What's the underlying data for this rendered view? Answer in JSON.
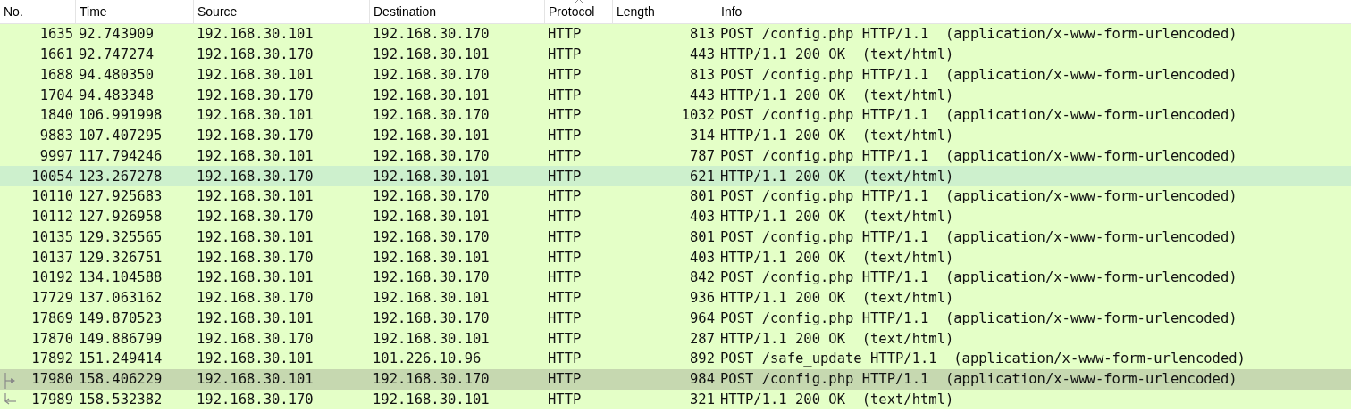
{
  "columns": [
    {
      "label": "No.",
      "kind": "number",
      "sorted": false
    },
    {
      "label": "Time",
      "kind": "text",
      "sorted": false
    },
    {
      "label": "Source",
      "kind": "text",
      "sorted": false
    },
    {
      "label": "Destination",
      "kind": "text",
      "sorted": false
    },
    {
      "label": "Protocol",
      "kind": "text",
      "sorted": true
    },
    {
      "label": "Length",
      "kind": "number",
      "sorted": false
    },
    {
      "label": "Info",
      "kind": "text",
      "sorted": false
    }
  ],
  "rows": [
    {
      "cells": [
        "1635",
        "92.743909",
        "192.168.30.101",
        "192.168.30.170",
        "HTTP",
        "813",
        "POST /config.php HTTP/1.1  (application/x-www-form-urlencoded)"
      ],
      "selected": false,
      "hovered": false
    },
    {
      "cells": [
        "1661",
        "92.747274",
        "192.168.30.170",
        "192.168.30.101",
        "HTTP",
        "443",
        "HTTP/1.1 200 OK  (text/html)"
      ],
      "selected": false,
      "hovered": false
    },
    {
      "cells": [
        "1688",
        "94.480350",
        "192.168.30.101",
        "192.168.30.170",
        "HTTP",
        "813",
        "POST /config.php HTTP/1.1  (application/x-www-form-urlencoded)"
      ],
      "selected": false,
      "hovered": false
    },
    {
      "cells": [
        "1704",
        "94.483348",
        "192.168.30.170",
        "192.168.30.101",
        "HTTP",
        "443",
        "HTTP/1.1 200 OK  (text/html)"
      ],
      "selected": false,
      "hovered": false
    },
    {
      "cells": [
        "1840",
        "106.991998",
        "192.168.30.101",
        "192.168.30.170",
        "HTTP",
        "1032",
        "POST /config.php HTTP/1.1  (application/x-www-form-urlencoded)"
      ],
      "selected": false,
      "hovered": false
    },
    {
      "cells": [
        "9883",
        "107.407295",
        "192.168.30.170",
        "192.168.30.101",
        "HTTP",
        "314",
        "HTTP/1.1 200 OK  (text/html)"
      ],
      "selected": false,
      "hovered": false
    },
    {
      "cells": [
        "9997",
        "117.794246",
        "192.168.30.101",
        "192.168.30.170",
        "HTTP",
        "787",
        "POST /config.php HTTP/1.1  (application/x-www-form-urlencoded)"
      ],
      "selected": false,
      "hovered": false
    },
    {
      "cells": [
        "10054",
        "123.267278",
        "192.168.30.170",
        "192.168.30.101",
        "HTTP",
        "621",
        "HTTP/1.1 200 OK  (text/html)"
      ],
      "selected": false,
      "hovered": true
    },
    {
      "cells": [
        "10110",
        "127.925683",
        "192.168.30.101",
        "192.168.30.170",
        "HTTP",
        "801",
        "POST /config.php HTTP/1.1  (application/x-www-form-urlencoded)"
      ],
      "selected": false,
      "hovered": false
    },
    {
      "cells": [
        "10112",
        "127.926958",
        "192.168.30.170",
        "192.168.30.101",
        "HTTP",
        "403",
        "HTTP/1.1 200 OK  (text/html)"
      ],
      "selected": false,
      "hovered": false
    },
    {
      "cells": [
        "10135",
        "129.325565",
        "192.168.30.101",
        "192.168.30.170",
        "HTTP",
        "801",
        "POST /config.php HTTP/1.1  (application/x-www-form-urlencoded)"
      ],
      "selected": false,
      "hovered": false
    },
    {
      "cells": [
        "10137",
        "129.326751",
        "192.168.30.170",
        "192.168.30.101",
        "HTTP",
        "403",
        "HTTP/1.1 200 OK  (text/html)"
      ],
      "selected": false,
      "hovered": false
    },
    {
      "cells": [
        "10192",
        "134.104588",
        "192.168.30.101",
        "192.168.30.170",
        "HTTP",
        "842",
        "POST /config.php HTTP/1.1  (application/x-www-form-urlencoded)"
      ],
      "selected": false,
      "hovered": false
    },
    {
      "cells": [
        "17729",
        "137.063162",
        "192.168.30.170",
        "192.168.30.101",
        "HTTP",
        "936",
        "HTTP/1.1 200 OK  (text/html)"
      ],
      "selected": false,
      "hovered": false
    },
    {
      "cells": [
        "17869",
        "149.870523",
        "192.168.30.101",
        "192.168.30.170",
        "HTTP",
        "964",
        "POST /config.php HTTP/1.1  (application/x-www-form-urlencoded)"
      ],
      "selected": false,
      "hovered": false
    },
    {
      "cells": [
        "17870",
        "149.886799",
        "192.168.30.170",
        "192.168.30.101",
        "HTTP",
        "287",
        "HTTP/1.1 200 OK  (text/html)"
      ],
      "selected": false,
      "hovered": false
    },
    {
      "cells": [
        "17892",
        "151.249414",
        "192.168.30.101",
        "101.226.10.96",
        "HTTP",
        "892",
        "POST /safe_update HTTP/1.1  (application/x-www-form-urlencoded)"
      ],
      "selected": false,
      "hovered": false
    },
    {
      "cells": [
        "17980",
        "158.406229",
        "192.168.30.101",
        "192.168.30.170",
        "HTTP",
        "984",
        "POST /config.php HTTP/1.1  (application/x-www-form-urlencoded)"
      ],
      "selected": true,
      "hovered": false,
      "kind": "request"
    },
    {
      "cells": [
        "17989",
        "158.532382",
        "192.168.30.170",
        "192.168.30.101",
        "HTTP",
        "321",
        "HTTP/1.1 200 OK  (text/html)"
      ],
      "selected": false,
      "hovered": false,
      "kind": "response"
    }
  ]
}
